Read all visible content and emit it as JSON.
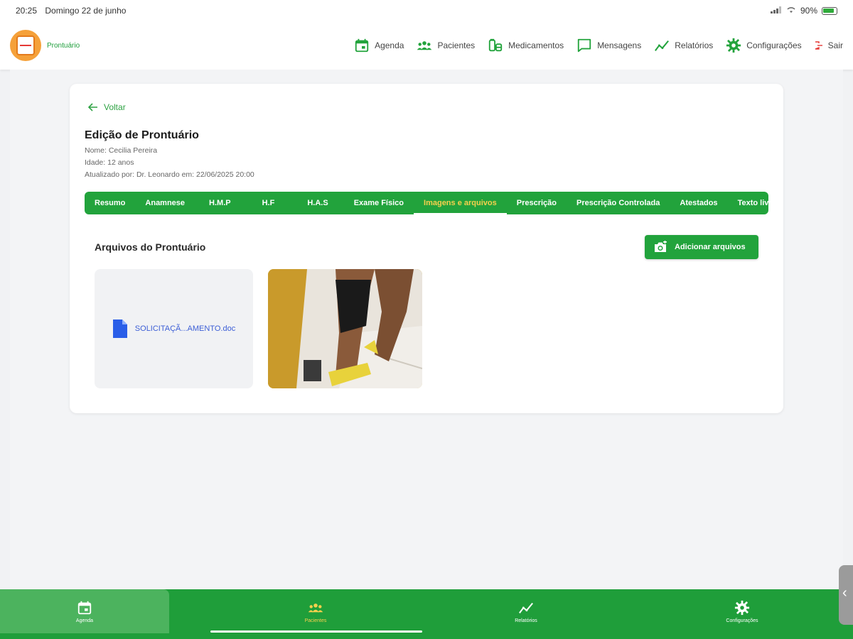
{
  "status_bar": {
    "time": "20:25",
    "date": "Domingo 22 de junho",
    "battery": "90%"
  },
  "app": {
    "brand": "Prontuário"
  },
  "nav": {
    "items": [
      {
        "label": "Agenda",
        "icon": "calendar-icon"
      },
      {
        "label": "Pacientes",
        "icon": "people-icon"
      },
      {
        "label": "Medicamentos",
        "icon": "pill-icon"
      },
      {
        "label": "Mensagens",
        "icon": "message-icon"
      },
      {
        "label": "Relatórios",
        "icon": "chart-icon"
      },
      {
        "label": "Configurações",
        "icon": "gear-icon"
      }
    ],
    "exit": "Sair"
  },
  "record": {
    "back": "Voltar",
    "title": "Edição de Prontuário",
    "name": "Nome: Cecilia Pereira",
    "age": "Idade: 12 anos",
    "updated": "Atualizado por: Dr. Leonardo em: 22/06/2025 20:00"
  },
  "tabs": [
    {
      "label": "Resumo"
    },
    {
      "label": "Anamnese"
    },
    {
      "label": "H.M.P"
    },
    {
      "label": "H.F"
    },
    {
      "label": "H.A.S"
    },
    {
      "label": "Exame Físico"
    },
    {
      "label": "Imagens e arquivos",
      "active": true
    },
    {
      "label": "Prescrição"
    },
    {
      "label": "Prescrição Controlada"
    },
    {
      "label": "Atestados"
    },
    {
      "label": "Texto livre"
    }
  ],
  "files": {
    "section_title": "Arquivos do Prontuário",
    "add_button": "Adicionar arquivos",
    "doc_name": "SOLICITAÇÃ...AMENTO.doc"
  },
  "bottom_nav": [
    {
      "label": "Agenda"
    },
    {
      "label": "Pacientes"
    },
    {
      "label": "Relatórios"
    },
    {
      "label": "Configurações"
    }
  ],
  "colors": {
    "primary": "#22a33c",
    "accent_active_tab": "#f6d04d",
    "link": "#3d5fd6"
  }
}
